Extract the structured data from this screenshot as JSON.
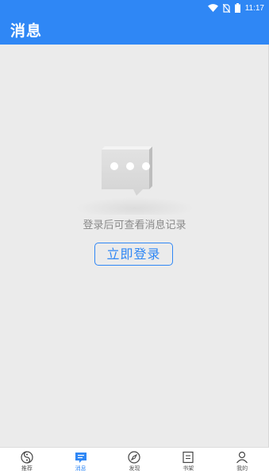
{
  "status_bar": {
    "time": "11:17",
    "icons": [
      "wifi-icon",
      "sim-off-icon",
      "battery-icon"
    ]
  },
  "header": {
    "title": "消息",
    "background_color": "#2f87f5"
  },
  "main": {
    "empty_icon": "chat-bubble-icon",
    "empty_message": "登录后可查看消息记录",
    "login_button_label": "立即登录"
  },
  "bottom_nav": {
    "items": [
      {
        "label": "推荐",
        "icon": "yin-yang-icon",
        "active": false
      },
      {
        "label": "消息",
        "icon": "message-icon",
        "active": true
      },
      {
        "label": "发现",
        "icon": "compass-icon",
        "active": false
      },
      {
        "label": "书架",
        "icon": "bookshelf-icon",
        "active": false
      },
      {
        "label": "我的",
        "icon": "person-icon",
        "active": false
      }
    ]
  }
}
